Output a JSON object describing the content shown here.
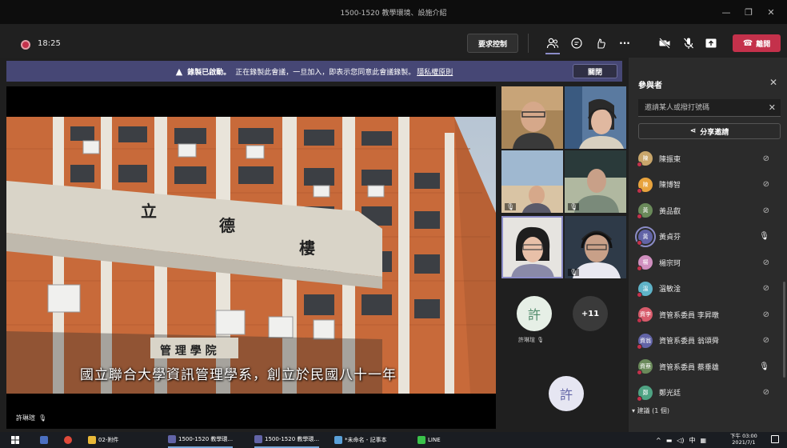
{
  "window": {
    "title": "1500-1520 教學環境、設施介紹",
    "controls": [
      "—",
      "❐",
      "✕"
    ]
  },
  "toolbar": {
    "timer": "18:25",
    "request_control": "要求控制",
    "icons": [
      "people-icon",
      "chat-icon",
      "reactions-icon",
      "more-icon",
      "camera-off-icon",
      "mic-off-icon",
      "share-icon"
    ],
    "more_label": "···",
    "hangup_label": "離開"
  },
  "banner": {
    "bold": "錄製已啟動。",
    "text": "正在錄製此會議，一旦加入，即表示您同意此會議錄製。",
    "link": "隱私權原則",
    "close": "關閉"
  },
  "main_video": {
    "subtitle": "國立聯合大學資訊管理學系，創立於民國八十一年",
    "sign_top_left": "立",
    "sign_top_mid": "德",
    "sign_top_right": "樓",
    "sign_lower": "管 理 學 院",
    "speaker_name": "許琳瑄"
  },
  "gallery": {
    "avatar_xu": "許",
    "more_count": "+11",
    "xu_label": "許琳瑄",
    "avatar_xu2": "許"
  },
  "panel": {
    "title": "參與者",
    "invite_placeholder": "邀請某人或撥打號碼",
    "share_invite": "分享邀請",
    "participants": [
      {
        "name": "陳振東",
        "avatar": "陳",
        "color": "#c9a66b",
        "mic": "muted"
      },
      {
        "name": "陳博智",
        "avatar": "陳",
        "color": "#e8a33d",
        "mic": "muted"
      },
      {
        "name": "黃品叡",
        "avatar": "黃",
        "color": "#6a8a5a",
        "mic": "muted"
      },
      {
        "name": "黃貞芬",
        "avatar": "黃",
        "color": "#6264a7",
        "mic": "on"
      },
      {
        "name": "楊宗珂",
        "avatar": "楊",
        "color": "#d08fbf",
        "mic": "muted"
      },
      {
        "name": "溫敏淦",
        "avatar": "溫",
        "color": "#5fb3c8",
        "mic": "muted"
      },
      {
        "name": "資管系委員 李昇暾",
        "avatar": "資李",
        "color": "#d75b6b",
        "mic": "muted"
      },
      {
        "name": "資管系委員 翁頌舜",
        "avatar": "資翁",
        "color": "#6264a7",
        "mic": "muted"
      },
      {
        "name": "資管系委員 蔡垂雄",
        "avatar": "資蔡",
        "color": "#6a8a5a",
        "mic": "on"
      },
      {
        "name": "鄭光廷",
        "avatar": "鄭",
        "color": "#4fa383",
        "mic": "muted"
      }
    ],
    "suggested": "建議 (1 個)"
  },
  "taskbar": {
    "items": [
      "02-附件",
      "1500-1520 教學環...",
      "1500-1520 教學環...",
      "*未命名 - 記事本",
      "LINE"
    ],
    "ime": "中",
    "time": "下午 03:00",
    "date": "2021/7/1"
  }
}
